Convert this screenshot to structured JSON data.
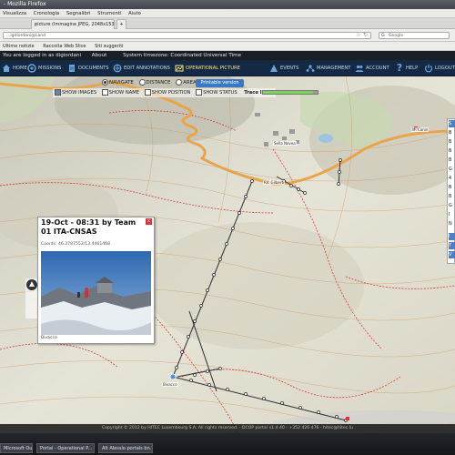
{
  "window": {
    "title": "- Mozilla Firefox"
  },
  "menubar": [
    "Visualizza",
    "Cronologia",
    "Segnalibri",
    "Strumenti",
    "Aiuto"
  ],
  "tabs": [
    {
      "label": "picture (Immagine JPEG, 2048x1536 pixel)"
    },
    {
      "label": "+"
    }
  ],
  "urlbar": {
    "value": "...igdiordani@Land"
  },
  "searchbar": {
    "placeholder": "Google"
  },
  "bookmarks": [
    "Ultime notizie",
    "Raccolta Web Slice",
    "Siti suggeriti"
  ],
  "app": {
    "status_left": "You are logged in as digiordani",
    "about": "About",
    "timezone": "System timezone: Coordinated Universal Time",
    "nav": [
      {
        "label": "HOME",
        "icon": "home-icon"
      },
      {
        "label": "MISSIONS",
        "icon": "missions-icon"
      },
      {
        "label": "DOCUMENTS",
        "icon": "documents-icon"
      },
      {
        "label": "EDIT ANNOTATIONS",
        "icon": "annotations-icon"
      },
      {
        "label": "OPERATIONAL PICTURE",
        "icon": "operational-icon"
      },
      {
        "label": "EVENTS",
        "icon": "events-icon"
      },
      {
        "label": "MANAGEMENT",
        "icon": "management-icon"
      },
      {
        "label": "ACCOUNT",
        "icon": "account-icon"
      },
      {
        "label": "HELP",
        "icon": "help-icon"
      },
      {
        "label": "LOGOUT",
        "icon": "logout-icon"
      }
    ],
    "active_nav": "OPERATIONAL PICTURE",
    "accent": "#ffe880",
    "nav_bg": "#142a44"
  },
  "controls": {
    "modes": [
      "NAVIGATE",
      "DISTANCE",
      "AREA"
    ],
    "selected_mode": "NAVIGATE",
    "printable": "Printable version",
    "show_images": "SHOW IMAGES",
    "show_name": "SHOW NAME",
    "show_position": "SHOW POSITION",
    "show_status": "SHOW STATUS",
    "trace_limit": "Trace limit:",
    "trace_limit_value": 0.92
  },
  "map": {
    "labels": {
      "town_top": "Sella Nevea",
      "hut": "Rif. Gilberti",
      "peak_right": "M. Canin",
      "end_point": "Bivacco"
    }
  },
  "popup": {
    "title": "19-Oct - 08:31 by Team 01 ITA-CNSAS",
    "coords": "Coords: 46.3787553/13.4461468",
    "author": "Bivacco",
    "close": "x"
  },
  "sidepanel": [
    "S",
    "B",
    "B",
    "B",
    "B",
    "G",
    "4",
    "B",
    "B",
    "G",
    "I",
    "N",
    "I",
    "T",
    "V"
  ],
  "footer": "Copyright © 2012 by HITEC Luxembourg S.A. All rights reserved. - DCOP portal v1.4.40 - +352 426 476 - hitec@hitec.lu",
  "taskbar": [
    "Microsoft Out...",
    "Portal - Operational P...",
    "Alt Alessio portals bn..."
  ]
}
